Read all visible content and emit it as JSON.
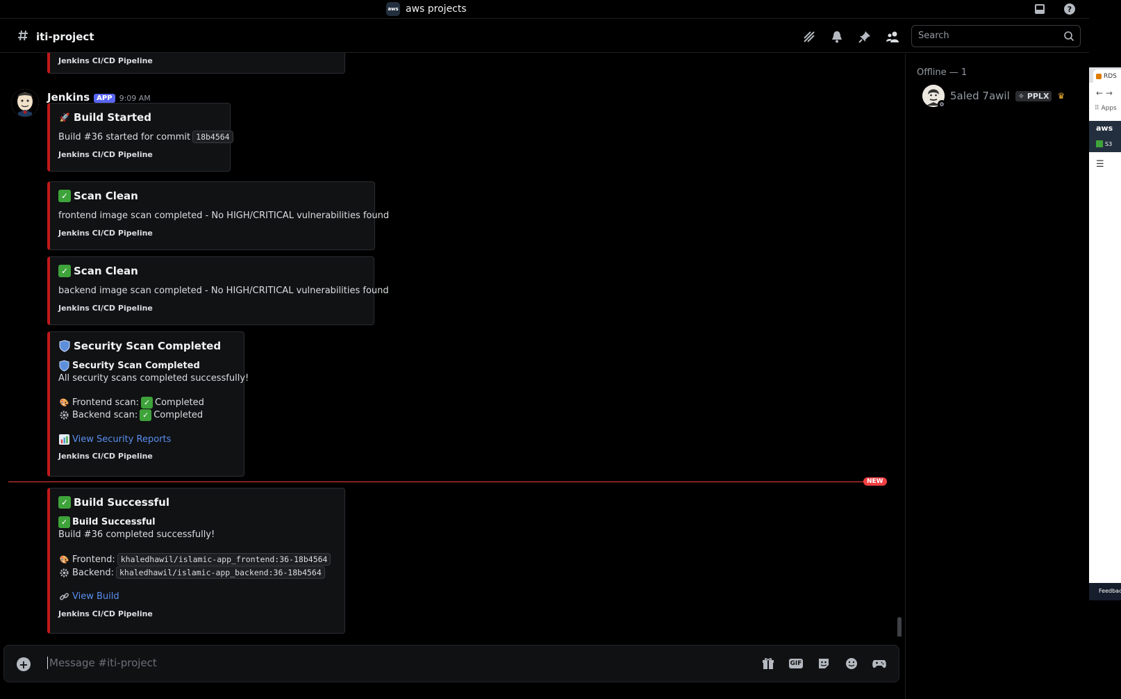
{
  "topbar": {
    "server_name": "aws projects",
    "server_icon_text": "aws"
  },
  "channel": {
    "name": "iti-project",
    "search_placeholder": "Search"
  },
  "message": {
    "author": "Jenkins",
    "badge": "APP",
    "timestamp": "9:09 AM"
  },
  "embeds": {
    "partial": {
      "footer": "Jenkins CI/CD Pipeline"
    },
    "build_started": {
      "title": "Build Started",
      "desc_text": "Build #36 started for commit",
      "commit": "18b4564",
      "footer": "Jenkins CI/CD Pipeline"
    },
    "scan_frontend": {
      "title": "Scan Clean",
      "desc": "frontend image scan completed - No HIGH/CRITICAL vulnerabilities found",
      "footer": "Jenkins CI/CD Pipeline"
    },
    "scan_backend": {
      "title": "Scan Clean",
      "desc": "backend image scan completed - No HIGH/CRITICAL vulnerabilities found",
      "footer": "Jenkins CI/CD Pipeline"
    },
    "security": {
      "title": "Security Scan Completed",
      "subtitle": "Security Scan Completed",
      "summary": "All security scans completed successfully!",
      "frontend_label": "Frontend scan:",
      "frontend_status": "Completed",
      "backend_label": "Backend scan:",
      "backend_status": "Completed",
      "link": "View Security Reports",
      "footer": "Jenkins CI/CD Pipeline"
    },
    "build_success": {
      "title": "Build Successful",
      "subtitle": "Build Successful",
      "summary": "Build #36 completed successfully!",
      "frontend_label": "Frontend:",
      "frontend_image": "khaledhawil/islamic-app_frontend:36-18b4564",
      "backend_label": "Backend:",
      "backend_image": "khaledhawil/islamic-app_backend:36-18b4564",
      "link": "View Build",
      "footer": "Jenkins CI/CD Pipeline"
    }
  },
  "new_divider": "NEW",
  "composer": {
    "placeholder": "Message #iti-project",
    "gif_label": "GIF"
  },
  "members": {
    "section": "Offline — 1",
    "list": [
      {
        "name": "5aled 7awil",
        "tag": "PPLX"
      }
    ]
  },
  "sliver": {
    "tab": "RDS",
    "apps": "Apps",
    "aws": "aws",
    "s3": "S3",
    "feedback": "Feedback"
  },
  "colors": {
    "embed_border": "#c21818",
    "link": "#5a8ff0",
    "badge": "#5865f2",
    "new": "#f23f43",
    "check": "#3ea33a"
  }
}
